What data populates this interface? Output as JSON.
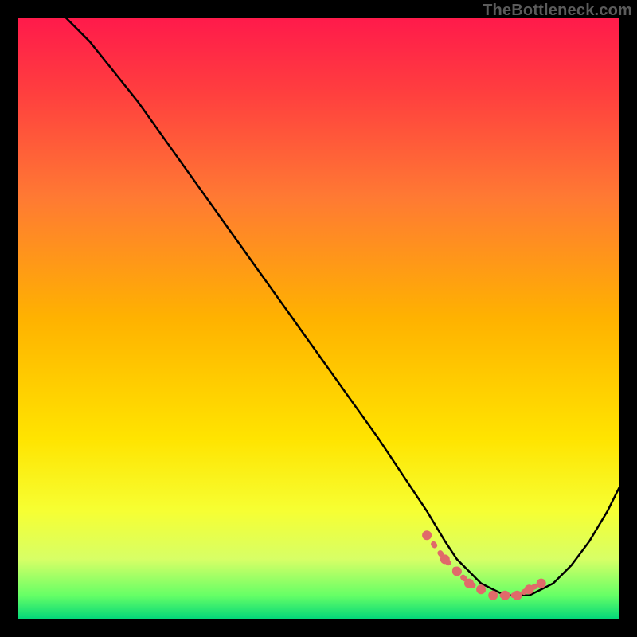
{
  "watermark": "TheBottleneck.com",
  "gradient": {
    "stops": [
      {
        "offset": 0.0,
        "color": "#ff1a4b"
      },
      {
        "offset": 0.12,
        "color": "#ff3d3f"
      },
      {
        "offset": 0.3,
        "color": "#ff7a33"
      },
      {
        "offset": 0.5,
        "color": "#ffb200"
      },
      {
        "offset": 0.7,
        "color": "#ffe400"
      },
      {
        "offset": 0.82,
        "color": "#f6ff33"
      },
      {
        "offset": 0.9,
        "color": "#d7ff66"
      },
      {
        "offset": 0.96,
        "color": "#66ff66"
      },
      {
        "offset": 1.0,
        "color": "#00d67a"
      }
    ]
  },
  "chart_data": {
    "type": "line",
    "title": "",
    "xlabel": "",
    "ylabel": "",
    "xlim": [
      0,
      100
    ],
    "ylim": [
      0,
      100
    ],
    "series": [
      {
        "name": "bottleneck-curve",
        "x": [
          8,
          12,
          16,
          20,
          25,
          30,
          35,
          40,
          45,
          50,
          55,
          60,
          64,
          68,
          71,
          73,
          75,
          77,
          79,
          81,
          83,
          85,
          87,
          89,
          92,
          95,
          98,
          100
        ],
        "values": [
          100,
          96,
          91,
          86,
          79,
          72,
          65,
          58,
          51,
          44,
          37,
          30,
          24,
          18,
          13,
          10,
          8,
          6,
          5,
          4,
          4,
          4,
          5,
          6,
          9,
          13,
          18,
          22
        ]
      }
    ],
    "markers": {
      "name": "optimal-region",
      "color": "#e06a6a",
      "radius": 6,
      "x": [
        68,
        71,
        73,
        75,
        77,
        79,
        81,
        83,
        85,
        87
      ],
      "values": [
        14,
        10,
        8,
        6,
        5,
        4,
        4,
        4,
        5,
        6
      ]
    }
  }
}
